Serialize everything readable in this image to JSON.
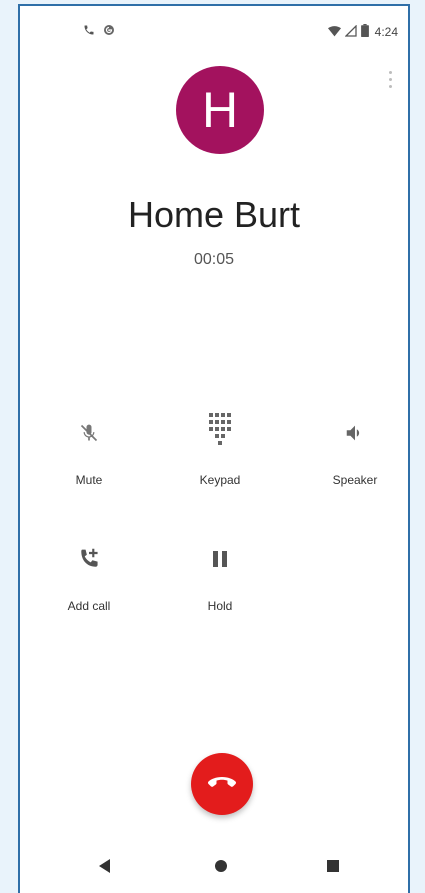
{
  "status_bar": {
    "left_icons": [
      "phone-icon",
      "notification-g-icon"
    ],
    "right_icons": [
      "wifi-icon",
      "signal-icon",
      "battery-icon"
    ],
    "time": "4:24"
  },
  "contact": {
    "avatar_letter": "H",
    "avatar_color": "#a3125e",
    "name": "Home Burt",
    "timer": "00:05"
  },
  "controls": [
    {
      "label": "Mute",
      "icon": "mic-off-icon"
    },
    {
      "label": "Keypad",
      "icon": "dialpad-icon"
    },
    {
      "label": "Speaker",
      "icon": "speaker-icon"
    },
    {
      "label": "Add call",
      "icon": "add-call-icon"
    },
    {
      "label": "Hold",
      "icon": "pause-icon"
    }
  ],
  "end_call": {
    "icon": "end-call-icon",
    "color": "#e31c1c"
  },
  "nav": {
    "icons": [
      "back-icon",
      "home-icon",
      "recents-icon"
    ]
  }
}
